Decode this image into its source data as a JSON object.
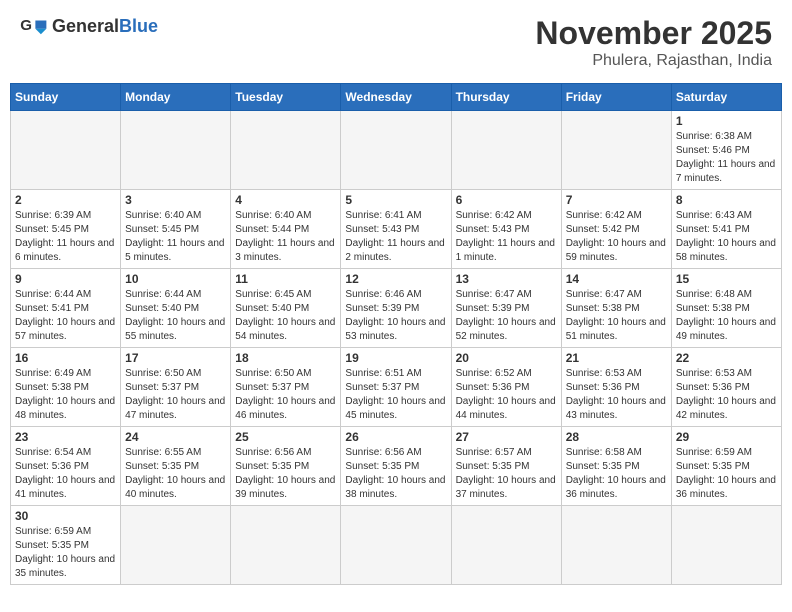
{
  "header": {
    "logo_general": "General",
    "logo_blue": "Blue",
    "month_year": "November 2025",
    "location": "Phulera, Rajasthan, India"
  },
  "weekdays": [
    "Sunday",
    "Monday",
    "Tuesday",
    "Wednesday",
    "Thursday",
    "Friday",
    "Saturday"
  ],
  "weeks": [
    [
      {
        "day": "",
        "info": ""
      },
      {
        "day": "",
        "info": ""
      },
      {
        "day": "",
        "info": ""
      },
      {
        "day": "",
        "info": ""
      },
      {
        "day": "",
        "info": ""
      },
      {
        "day": "",
        "info": ""
      },
      {
        "day": "1",
        "info": "Sunrise: 6:38 AM\nSunset: 5:46 PM\nDaylight: 11 hours\nand 7 minutes."
      }
    ],
    [
      {
        "day": "2",
        "info": "Sunrise: 6:39 AM\nSunset: 5:45 PM\nDaylight: 11 hours\nand 6 minutes."
      },
      {
        "day": "3",
        "info": "Sunrise: 6:40 AM\nSunset: 5:45 PM\nDaylight: 11 hours\nand 5 minutes."
      },
      {
        "day": "4",
        "info": "Sunrise: 6:40 AM\nSunset: 5:44 PM\nDaylight: 11 hours\nand 3 minutes."
      },
      {
        "day": "5",
        "info": "Sunrise: 6:41 AM\nSunset: 5:43 PM\nDaylight: 11 hours\nand 2 minutes."
      },
      {
        "day": "6",
        "info": "Sunrise: 6:42 AM\nSunset: 5:43 PM\nDaylight: 11 hours\nand 1 minute."
      },
      {
        "day": "7",
        "info": "Sunrise: 6:42 AM\nSunset: 5:42 PM\nDaylight: 10 hours\nand 59 minutes."
      },
      {
        "day": "8",
        "info": "Sunrise: 6:43 AM\nSunset: 5:41 PM\nDaylight: 10 hours\nand 58 minutes."
      }
    ],
    [
      {
        "day": "9",
        "info": "Sunrise: 6:44 AM\nSunset: 5:41 PM\nDaylight: 10 hours\nand 57 minutes."
      },
      {
        "day": "10",
        "info": "Sunrise: 6:44 AM\nSunset: 5:40 PM\nDaylight: 10 hours\nand 55 minutes."
      },
      {
        "day": "11",
        "info": "Sunrise: 6:45 AM\nSunset: 5:40 PM\nDaylight: 10 hours\nand 54 minutes."
      },
      {
        "day": "12",
        "info": "Sunrise: 6:46 AM\nSunset: 5:39 PM\nDaylight: 10 hours\nand 53 minutes."
      },
      {
        "day": "13",
        "info": "Sunrise: 6:47 AM\nSunset: 5:39 PM\nDaylight: 10 hours\nand 52 minutes."
      },
      {
        "day": "14",
        "info": "Sunrise: 6:47 AM\nSunset: 5:38 PM\nDaylight: 10 hours\nand 51 minutes."
      },
      {
        "day": "15",
        "info": "Sunrise: 6:48 AM\nSunset: 5:38 PM\nDaylight: 10 hours\nand 49 minutes."
      }
    ],
    [
      {
        "day": "16",
        "info": "Sunrise: 6:49 AM\nSunset: 5:38 PM\nDaylight: 10 hours\nand 48 minutes."
      },
      {
        "day": "17",
        "info": "Sunrise: 6:50 AM\nSunset: 5:37 PM\nDaylight: 10 hours\nand 47 minutes."
      },
      {
        "day": "18",
        "info": "Sunrise: 6:50 AM\nSunset: 5:37 PM\nDaylight: 10 hours\nand 46 minutes."
      },
      {
        "day": "19",
        "info": "Sunrise: 6:51 AM\nSunset: 5:37 PM\nDaylight: 10 hours\nand 45 minutes."
      },
      {
        "day": "20",
        "info": "Sunrise: 6:52 AM\nSunset: 5:36 PM\nDaylight: 10 hours\nand 44 minutes."
      },
      {
        "day": "21",
        "info": "Sunrise: 6:53 AM\nSunset: 5:36 PM\nDaylight: 10 hours\nand 43 minutes."
      },
      {
        "day": "22",
        "info": "Sunrise: 6:53 AM\nSunset: 5:36 PM\nDaylight: 10 hours\nand 42 minutes."
      }
    ],
    [
      {
        "day": "23",
        "info": "Sunrise: 6:54 AM\nSunset: 5:36 PM\nDaylight: 10 hours\nand 41 minutes."
      },
      {
        "day": "24",
        "info": "Sunrise: 6:55 AM\nSunset: 5:35 PM\nDaylight: 10 hours\nand 40 minutes."
      },
      {
        "day": "25",
        "info": "Sunrise: 6:56 AM\nSunset: 5:35 PM\nDaylight: 10 hours\nand 39 minutes."
      },
      {
        "day": "26",
        "info": "Sunrise: 6:56 AM\nSunset: 5:35 PM\nDaylight: 10 hours\nand 38 minutes."
      },
      {
        "day": "27",
        "info": "Sunrise: 6:57 AM\nSunset: 5:35 PM\nDaylight: 10 hours\nand 37 minutes."
      },
      {
        "day": "28",
        "info": "Sunrise: 6:58 AM\nSunset: 5:35 PM\nDaylight: 10 hours\nand 36 minutes."
      },
      {
        "day": "29",
        "info": "Sunrise: 6:59 AM\nSunset: 5:35 PM\nDaylight: 10 hours\nand 36 minutes."
      }
    ],
    [
      {
        "day": "30",
        "info": "Sunrise: 6:59 AM\nSunset: 5:35 PM\nDaylight: 10 hours\nand 35 minutes."
      },
      {
        "day": "",
        "info": ""
      },
      {
        "day": "",
        "info": ""
      },
      {
        "day": "",
        "info": ""
      },
      {
        "day": "",
        "info": ""
      },
      {
        "day": "",
        "info": ""
      },
      {
        "day": "",
        "info": ""
      }
    ]
  ]
}
